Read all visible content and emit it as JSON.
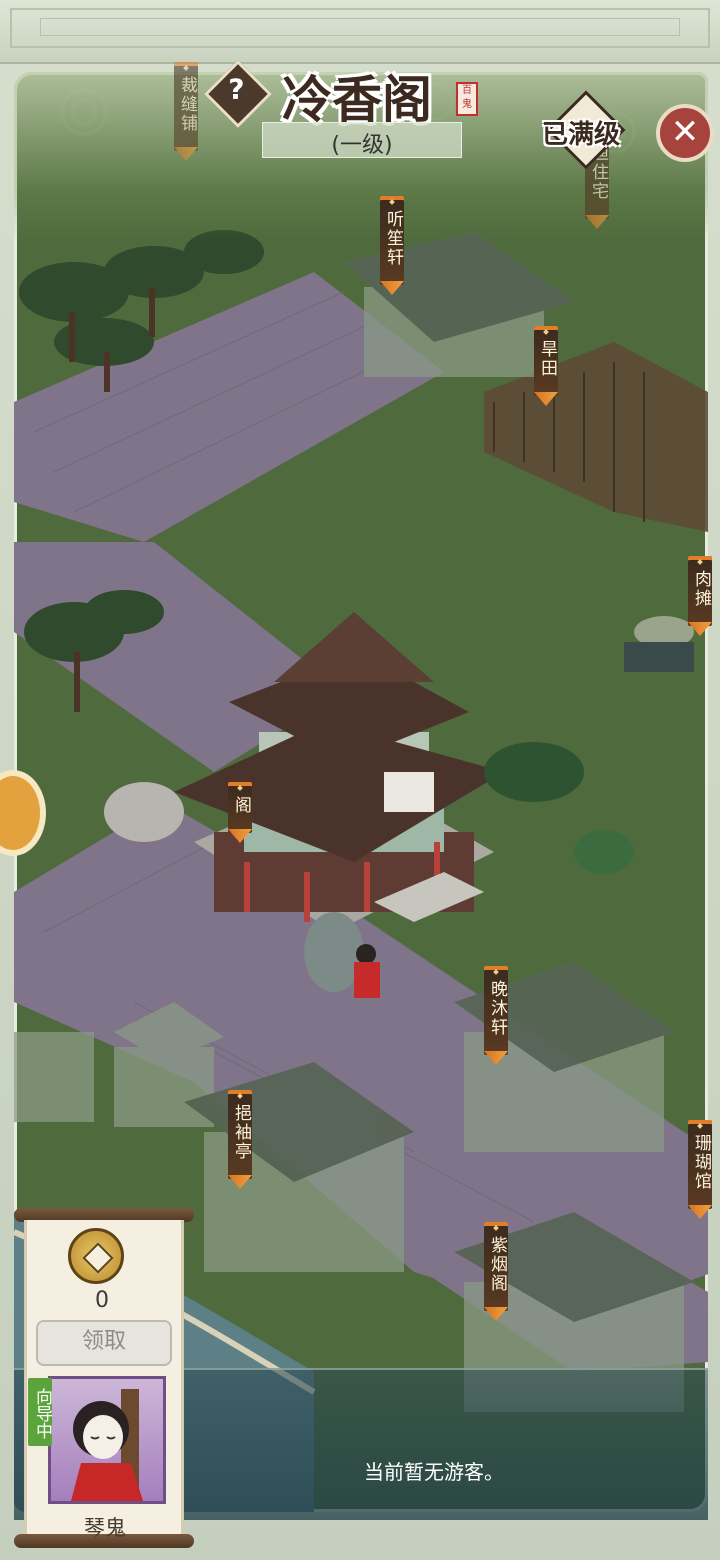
{
  "header": {
    "help_icon": "question-icon",
    "title": "冷香阁",
    "seal_text": "百鬼",
    "level": "(一级)",
    "max_level_label": "已满级",
    "close_icon": "close-icon"
  },
  "map": {
    "labels": [
      "裁缝铺",
      "渔住宅",
      "听笙轩",
      "旱田",
      "肉摊",
      "阁",
      "晚沐轩",
      "挹袖亭",
      "珊瑚馆",
      "紫烟阁"
    ]
  },
  "panel": {
    "coin_icon": "coin-icon",
    "coin_count": "0",
    "claim_label": "领取",
    "guide_tag": "向导中",
    "guide_name": "琴鬼"
  },
  "status": {
    "visitors": "当前暂无游客。"
  },
  "colors": {
    "grass": "#4f6a3c",
    "path": "#857b8e",
    "label_bg": "#3a2a1e",
    "label_accent": "#e47d2a",
    "close_button": "#a6433c"
  }
}
